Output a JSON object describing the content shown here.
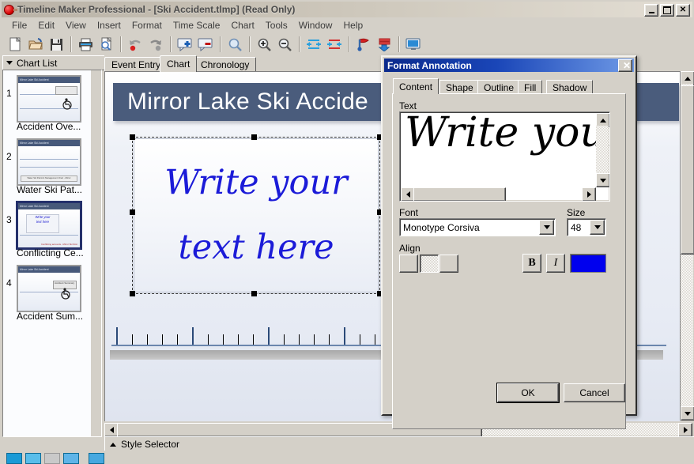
{
  "window": {
    "title": "Timeline Maker Professional - [Ski Accident.tlmp] (Read Only)",
    "icon": "app-timeline-icon",
    "minimize": "_",
    "maximize": "□",
    "close": "✕"
  },
  "menubar": {
    "items": [
      "File",
      "Edit",
      "View",
      "Insert",
      "Format",
      "Time Scale",
      "Chart",
      "Tools",
      "Window",
      "Help"
    ]
  },
  "toolbar": {
    "buttons": [
      {
        "name": "new-icon"
      },
      {
        "name": "open-folder-icon"
      },
      {
        "name": "save-floppy-icon"
      },
      {
        "name": "print-icon"
      },
      {
        "name": "print-preview-icon"
      },
      {
        "name": "undo-icon"
      },
      {
        "name": "redo-icon"
      },
      {
        "name": "add-annotation-icon"
      },
      {
        "name": "remove-annotation-icon"
      },
      {
        "name": "zoom-icon"
      },
      {
        "name": "zoom-in-icon"
      },
      {
        "name": "zoom-out-icon"
      },
      {
        "name": "expand-horizontal-icon"
      },
      {
        "name": "compress-horizontal-icon"
      },
      {
        "name": "flag-icon"
      },
      {
        "name": "stack-down-icon"
      },
      {
        "name": "display-icon"
      }
    ]
  },
  "sidebar": {
    "header": "Chart List",
    "items": [
      {
        "num": "1",
        "label": "Accident Ove...",
        "title": "Mirror Lake Ski Accident",
        "selected": false
      },
      {
        "num": "2",
        "label": "Water Ski Pat...",
        "title": "Mirror Lake Ski Accident",
        "selected": false,
        "footer": "Water Ski Patrol & Management Chart - Mirror"
      },
      {
        "num": "3",
        "label": "Conflicting Ce...",
        "title": "Mirror Lake Ski Accident",
        "selected": true,
        "annotation": "Write your\ntext here",
        "red_note": "Conflicting accounts - Mirror Ski Stmt"
      },
      {
        "num": "4",
        "label": "Accident Sum...",
        "title": "Mirror Lake Ski Accident",
        "selected": false,
        "box": "Accident Summary"
      }
    ]
  },
  "tabs": {
    "items": [
      {
        "label": "Event Entry",
        "active": false
      },
      {
        "label": "Chart",
        "active": true
      },
      {
        "label": "Chronology",
        "active": false
      }
    ]
  },
  "chart": {
    "header_title": "Mirror Lake Ski Accide",
    "annotation_text": "Write your\ntext here",
    "annotation_color": "#1b1bd8",
    "header_bg": "#4a5c7c"
  },
  "statusbar": {
    "style_selector": "Style Selector"
  },
  "dialog": {
    "title": "Format Annotation",
    "close": "✕",
    "tabs": [
      {
        "label": "Content",
        "active": true
      },
      {
        "label": "Shape",
        "active": false
      },
      {
        "label": "Outline",
        "active": false
      },
      {
        "label": "Fill",
        "active": false
      },
      {
        "label": "Shadow",
        "active": false
      }
    ],
    "text_label": "Text",
    "text_value": "Write your",
    "font_label": "Font",
    "font_value": "Monotype Corsiva",
    "size_label": "Size",
    "size_value": "48",
    "align_label": "Align",
    "align_options": [
      "align-left",
      "align-center",
      "align-right"
    ],
    "align_selected": "align-center",
    "bold_label": "B",
    "italic_label": "I",
    "color_value": "#0000ee",
    "ok_label": "OK",
    "cancel_label": "Cancel"
  }
}
